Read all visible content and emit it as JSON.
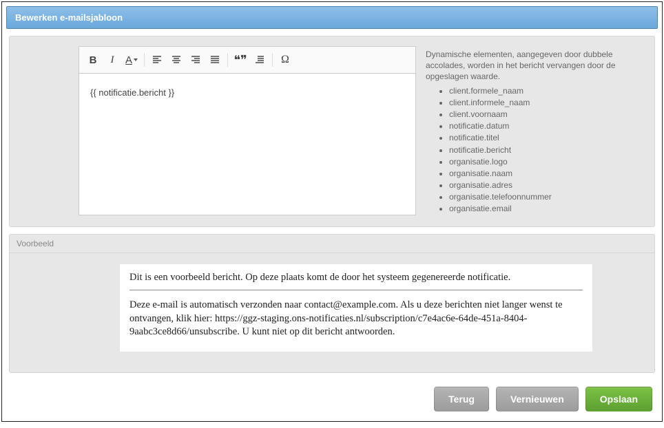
{
  "header": {
    "title": "Bewerken e-mailsjabloon"
  },
  "editor": {
    "content": "{{ notificatie.bericht }}",
    "icons": {
      "bold": "B",
      "italic": "I",
      "underline": "A",
      "quote": "❝❞",
      "omega": "Ω"
    }
  },
  "help": {
    "intro": "Dynamische elementen, aangegeven door dubbele accolades, worden in het bericht vervangen door de opgeslagen waarde.",
    "variables": [
      "client.formele_naam",
      "client.informele_naam",
      "client.voornaam",
      "notificatie.datum",
      "notificatie.titel",
      "notificatie.bericht",
      "organisatie.logo",
      "organisatie.naam",
      "organisatie.adres",
      "organisatie.telefoonnummer",
      "organisatie.email"
    ]
  },
  "preview": {
    "panel_title": "Voorbeeld",
    "line1": "Dit is een voorbeeld bericht. Op deze plaats komt de door het systeem gegenereerde notificatie.",
    "line2": "Deze e-mail is automatisch verzonden naar contact@example.com. Als u deze berichten niet langer wenst te ontvangen, klik hier: https://ggz-staging.ons-notificaties.nl/subscription/c7e4ac6e-64de-451a-8404-9aabc3ce8d66/unsubscribe. U kunt niet op dit bericht antwoorden."
  },
  "buttons": {
    "back": "Terug",
    "refresh": "Vernieuwen",
    "save": "Opslaan"
  }
}
